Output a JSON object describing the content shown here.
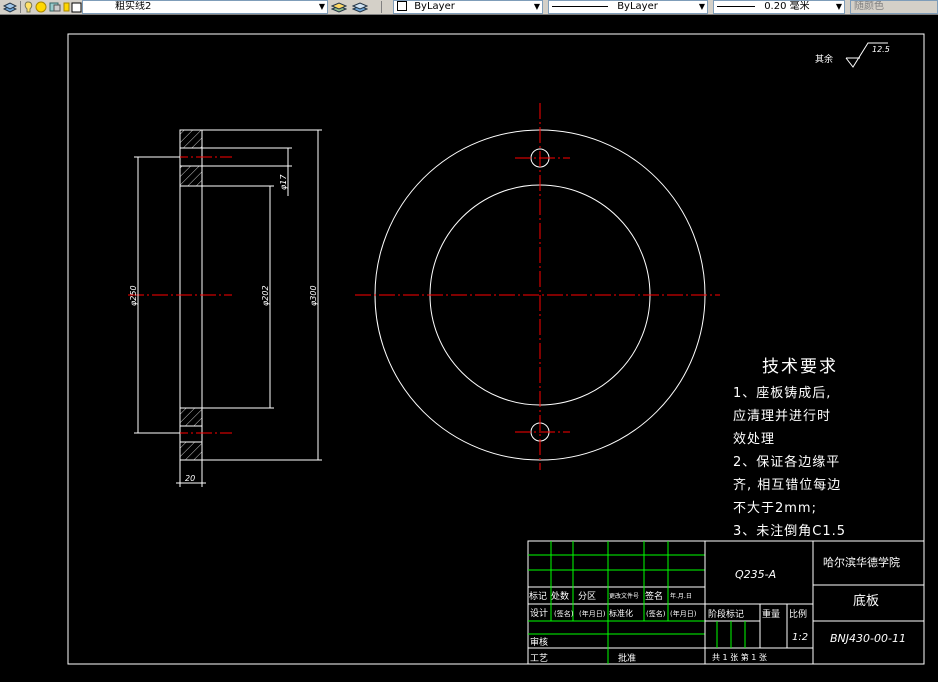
{
  "toolbar": {
    "layer_name": "粗实线2",
    "color_value": "ByLayer",
    "linetype_value": "ByLayer",
    "lineweight_value": "0.20 毫米",
    "plotstyle_value": "随颜色"
  },
  "roughness": {
    "prefix": "其余",
    "value": "12.5"
  },
  "dimensions": {
    "hole_dia": "φ17",
    "bolt_circle": "φ250",
    "inner_dia": "φ202",
    "outer_dia": "φ300",
    "thickness": "20"
  },
  "tech_requirements": {
    "title": "技术要求",
    "lines": [
      "1、座板铸成后,",
      "应清理并进行时",
      "效处理",
      "2、保证各边缘平",
      "齐, 相互错位每边",
      "不大于2mm;",
      "3、未注倒角C1.5"
    ]
  },
  "title_block": {
    "material": "Q235-A",
    "school": "哈尔滨华德学院",
    "part_name": "底板",
    "drawing_no": "BNJ430-00-11",
    "ratio": "1:2",
    "headers": {
      "mark": "标记",
      "count": "处数",
      "zone": "分区",
      "doc_no": "更改文件号",
      "sign": "签名",
      "date": "年.月.日",
      "design": "设计",
      "sign_bracket": "(签名)",
      "date_bracket": "(年月日)",
      "standard": "标准化",
      "stage_mark": "阶段标记",
      "weight": "重量",
      "scale": "比例",
      "review": "审核",
      "process": "工艺",
      "approve": "批准",
      "sheets": "共 1 张   第 1 张"
    }
  },
  "colors": {
    "background": "#000000",
    "line": "#ffffff",
    "center": "#ff0000",
    "border": "#ffffff",
    "toolbar": "#d4d0c8"
  }
}
